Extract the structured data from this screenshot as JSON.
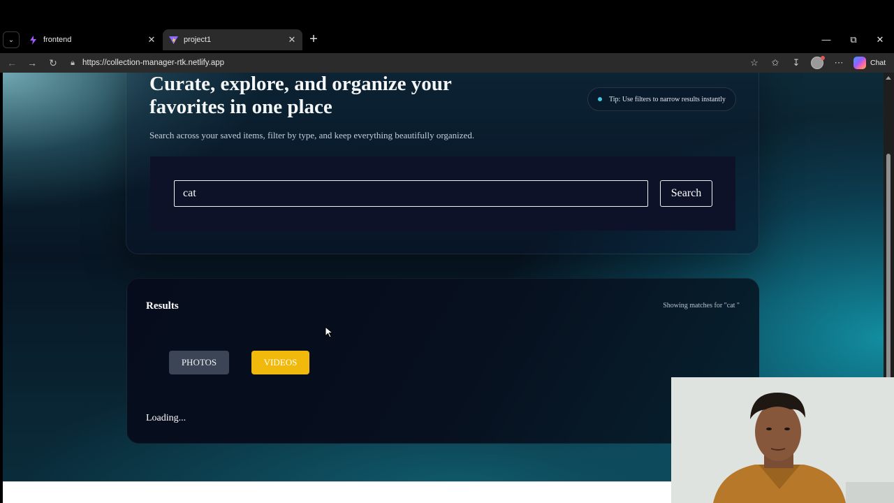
{
  "browser": {
    "tabs": [
      {
        "label": "frontend",
        "active": false
      },
      {
        "label": "project1",
        "active": true
      }
    ],
    "url": "https://collection-manager-rtk.netlify.app",
    "chat_label": "Chat"
  },
  "hero": {
    "title": "Curate, explore, and organize your favorites in one place",
    "subtitle": "Search across your saved items, filter by type, and keep everything beautifully organized.",
    "tip": "Tip: Use filters to narrow results instantly"
  },
  "search": {
    "value": "cat",
    "button_label": "Search"
  },
  "results": {
    "title": "Results",
    "meta": "Showing matches for \"cat \"",
    "filters": [
      {
        "label": "PHOTOS",
        "active": false
      },
      {
        "label": "VIDEOS",
        "active": true
      }
    ],
    "status": "Loading..."
  },
  "colors": {
    "accent_yellow": "#f0b90b",
    "inactive_filter": "#3b4555",
    "tip_dot": "#3ec8e6"
  }
}
